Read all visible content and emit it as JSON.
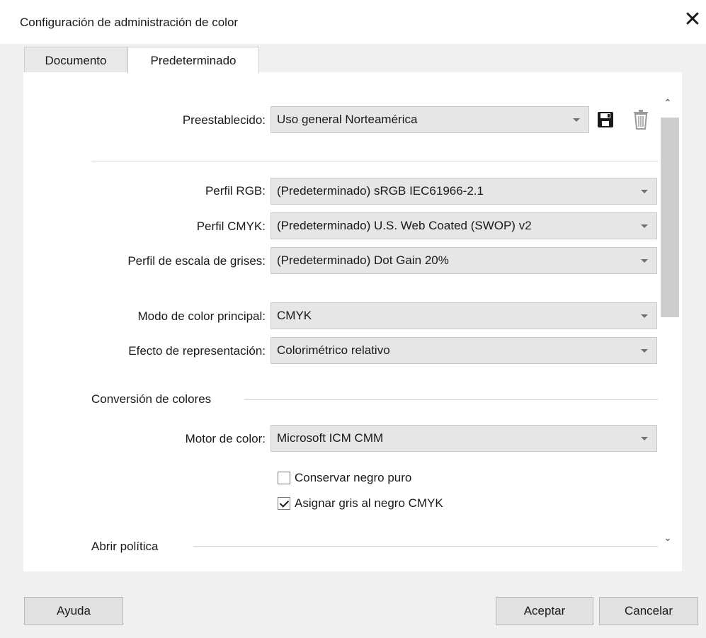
{
  "window": {
    "title": "Configuración de administración de color",
    "close_glyph": "✕"
  },
  "tabs": [
    {
      "label": "Documento"
    },
    {
      "label": "Predeterminado"
    }
  ],
  "preset": {
    "label": "Preestablecido:",
    "value": "Uso general Norteamérica",
    "save_icon": "save-icon",
    "delete_icon": "trash-icon"
  },
  "profiles": {
    "rgb": {
      "label": "Perfil RGB:",
      "value": "(Predeterminado) sRGB IEC61966-2.1"
    },
    "cmyk": {
      "label": "Perfil CMYK:",
      "value": "(Predeterminado) U.S. Web Coated (SWOP) v2"
    },
    "gray": {
      "label": "Perfil de escala de grises:",
      "value": "(Predeterminado) Dot Gain 20%"
    }
  },
  "color_mode": {
    "label": "Modo de color principal:",
    "value": "CMYK"
  },
  "rendering": {
    "label": "Efecto de representación:",
    "value": "Colorimétrico relativo"
  },
  "conversion": {
    "section_title": "Conversión de colores",
    "engine": {
      "label": "Motor de color:",
      "value": "Microsoft ICM CMM"
    },
    "preserve_black": {
      "label": "Conservar negro puro",
      "checked": false
    },
    "map_gray": {
      "label": "Asignar gris al negro CMYK",
      "checked": true
    }
  },
  "open_policy": {
    "section_title": "Abrir política"
  },
  "buttons": {
    "help": "Ayuda",
    "ok": "Aceptar",
    "cancel": "Cancelar"
  },
  "colors": {
    "background": "#f0f0f0",
    "panel": "#ffffff",
    "select_bg": "#e6e6e6",
    "scroll_thumb": "#cdcdcd"
  }
}
